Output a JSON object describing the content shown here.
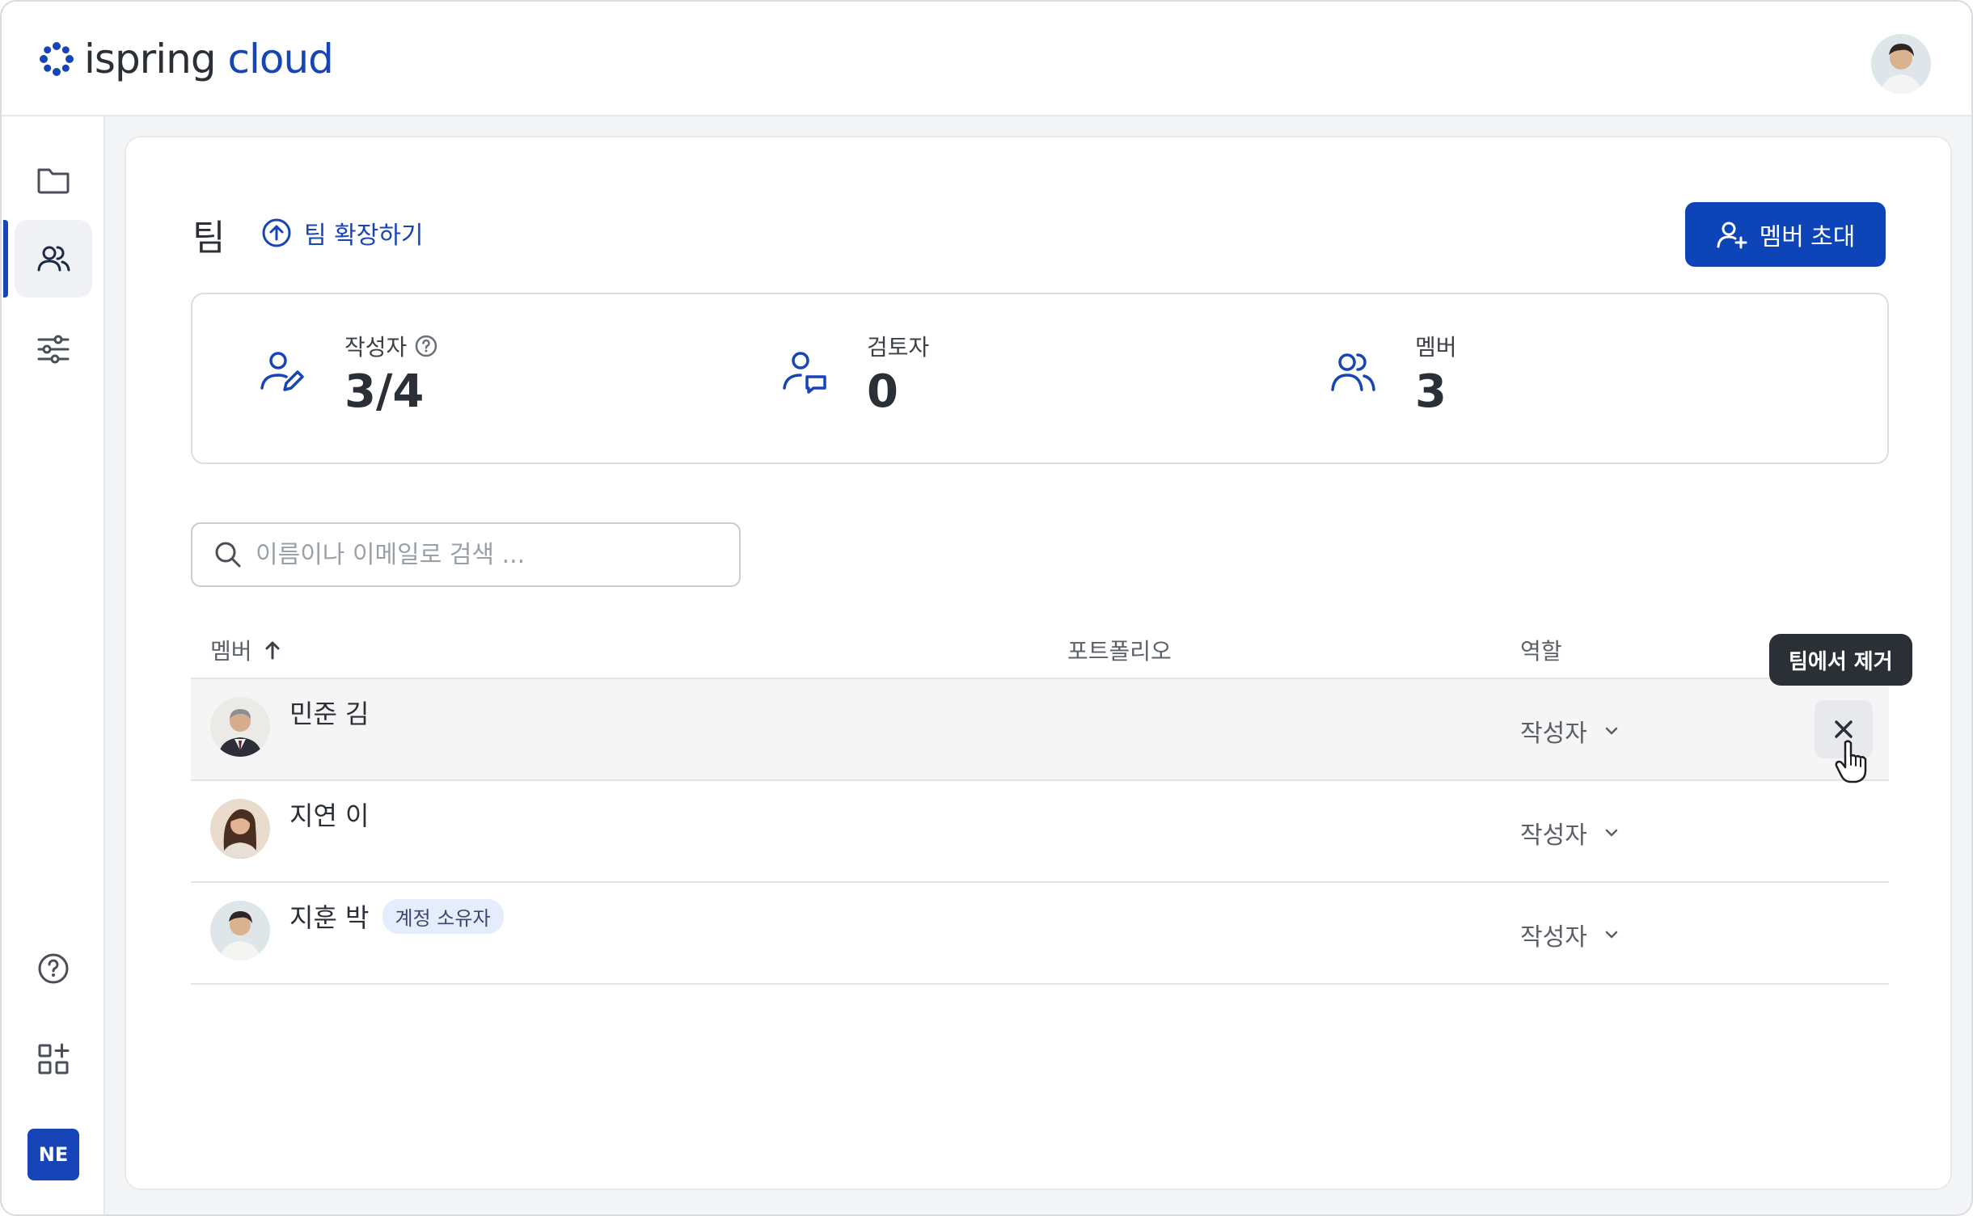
{
  "app": {
    "logo_part1": "ispring",
    "logo_part2": "cloud",
    "brand_color": "#1745b8"
  },
  "sidebar": {
    "items": [
      {
        "icon": "folder-icon"
      },
      {
        "icon": "users-icon",
        "active": true
      },
      {
        "icon": "sliders-icon"
      },
      {
        "icon": "help-icon"
      },
      {
        "icon": "add-apps-icon"
      }
    ],
    "workspace_badge": "NE"
  },
  "page": {
    "title": "팀",
    "expand_link": "팀 확장하기",
    "invite_button": "멤버 초대"
  },
  "stats": [
    {
      "label": "작성자",
      "value": "3/4",
      "icon": "author-icon",
      "has_help": true
    },
    {
      "label": "검토자",
      "value": "0",
      "icon": "reviewer-icon"
    },
    {
      "label": "멤버",
      "value": "3",
      "icon": "members-icon"
    }
  ],
  "search": {
    "placeholder": "이름이나 이메일로 검색 ..."
  },
  "table": {
    "columns": [
      "멤버",
      "포트폴리오",
      "역할"
    ],
    "rows": [
      {
        "name": "민준 김",
        "role": "작성자",
        "hovered": true
      },
      {
        "name": "지연 이",
        "role": "작성자"
      },
      {
        "name": "지훈 박",
        "role": "작성자",
        "badge": "계정 소유자"
      }
    ],
    "remove_tooltip": "팀에서 제거"
  }
}
